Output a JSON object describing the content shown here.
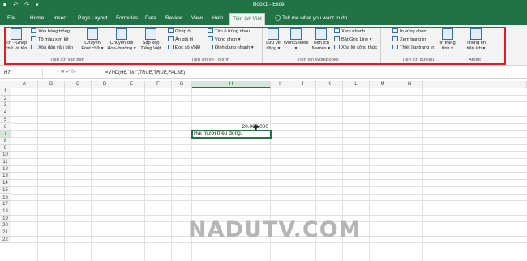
{
  "window": {
    "title": "Book1 - Excel",
    "qat": [
      "■",
      "↶",
      "↷",
      "▾"
    ]
  },
  "tabs": [
    "File",
    "Home",
    "Insert",
    "Page Layout",
    "Formulas",
    "Data",
    "Review",
    "View",
    "Help",
    "Tiện ích Việt"
  ],
  "tell_me": "Tell me what you want to do",
  "ribbon": {
    "g1": {
      "btn_ghep": "ích - Ghép",
      "btn_ghep2": "chữ và tên",
      "xoa_hang": "Xóa hàng trống",
      "to_mau": "Tô màu xen kẽ",
      "xoa_dau": "Xóa dấu văn bản",
      "chuyen_font": "Chuyển",
      "chuyen_font2": "Font chữ ▾",
      "chuyen_hoa": "Chuyển đổi",
      "chuyen_hoa2": "Hoa-thường ▾",
      "sap_xep": "Sắp xếp",
      "sap_xep2": "Tiếng Việt",
      "label": "Tiện ích văn bản"
    },
    "g2": {
      "ghep_o": "Ghép ô",
      "an_gia_tri": "Ẩn giá trị",
      "doc_so": "Đọc số VNĐ",
      "tim_o": "Tìm ô trùng nhau",
      "vung_chon": "Vùng chọn ▾",
      "dinh_dang": "Định dạng nhanh ▾",
      "label": "Tiện ích về - ô tính"
    },
    "g3": {
      "luu_ve": "Lưu về",
      "luu_ve2": "động ▾",
      "worksheets": "WorkSheets",
      "worksheets2": "▾",
      "tien_ich_names": "Tiện ích",
      "tien_ich_names2": "Names ▾",
      "xem_nhanh": "Xem nhanh",
      "bat_grid": "Bật Grid Line ▾",
      "xoa_loi": "Xóa lỗi công thức",
      "label": "Tiện ích WorkBooks"
    },
    "g4": {
      "in_vung": "In vùng chọn",
      "xem_trang": "Xem trang in",
      "thiet_lap": "Thiết lập trang in",
      "in_trang_tinh": "In trang",
      "in_trang_tinh2": "tính ▾",
      "label": "Tiện ích dữ liệu"
    },
    "g5": {
      "thong_tin": "Thông tin",
      "thong_tin2": "tiện ích ▾",
      "label": "About"
    }
  },
  "formula_bar": {
    "name_box": "H7",
    "icons": "▾  ✖  ✔  fx",
    "formula": "=VND(H6,\"Urí\",TRUE,TRUE,FALSE)"
  },
  "columns": [
    "A",
    "B",
    "C",
    "D",
    "E",
    "F",
    "G",
    "H",
    "I",
    "J",
    "K",
    "L",
    "M",
    "N"
  ],
  "rows": [
    "1",
    "2",
    "3",
    "4",
    "5",
    "6",
    "7",
    "8",
    "9",
    "10",
    "11",
    "12",
    "13",
    "14",
    "15",
    "16",
    "17",
    "18",
    "19",
    "20",
    "21",
    "22"
  ],
  "cells": {
    "h6": "20.000.000",
    "h7": "Hai mươi triệu đồng."
  },
  "watermark": "NADUTV.COM",
  "colors": {
    "excel_green": "#217346",
    "highlight_red": "#d9202a"
  }
}
